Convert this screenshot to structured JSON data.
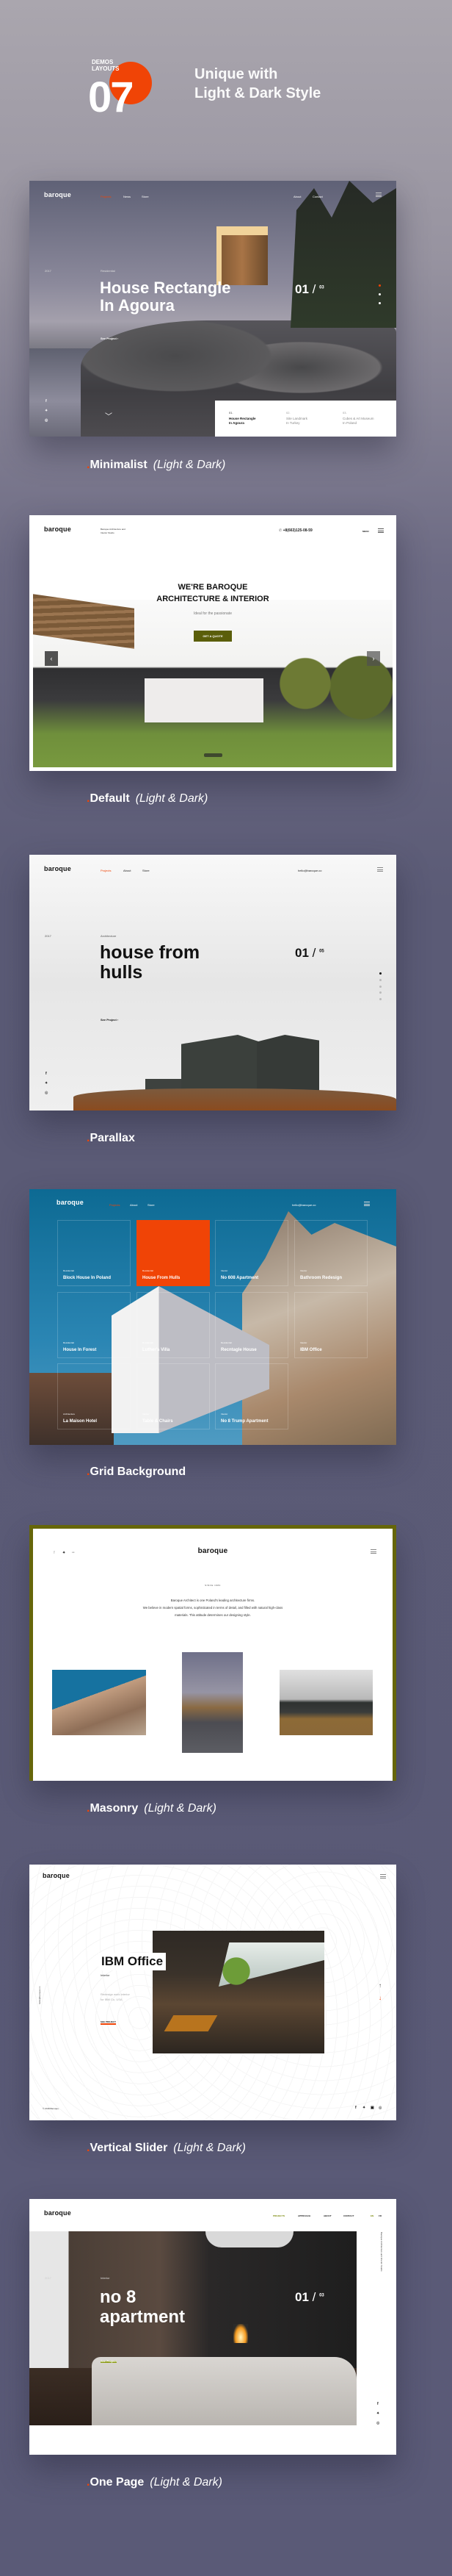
{
  "header": {
    "demos_label_line1": "DEMOS",
    "demos_label_line2": "LAYOUTS",
    "count": "07",
    "headline_line1": "Unique with",
    "headline_line2": "Light & Dark Style",
    "accent": "#f04406"
  },
  "demos": [
    {
      "label": "Minimalist",
      "note": "(Light & Dark)"
    },
    {
      "label": "Default",
      "note": "(Light & Dark)"
    },
    {
      "label": "Parallax",
      "note": ""
    },
    {
      "label": "Grid Background",
      "note": ""
    },
    {
      "label": "Masonry",
      "note": "(Light & Dark)"
    },
    {
      "label": "Vertical Slider",
      "note": "(Light & Dark)"
    },
    {
      "label": "One Page",
      "note": "(Light & Dark)"
    }
  ],
  "minimalist": {
    "logo": "baroque",
    "nav": [
      "Projects",
      "News",
      "Store"
    ],
    "nav_right": [
      "About",
      "Contact"
    ],
    "year": "2017",
    "category": "Residential",
    "title_line1": "House Rectangle",
    "title_line2": "In Agoura",
    "counter": "01",
    "total": "03",
    "see_project": "See Project",
    "slides": [
      {
        "num": "01.",
        "line1": "House Rectangle",
        "line2": "In Agoura"
      },
      {
        "num": "02.",
        "line1": "Site Landmark",
        "line2": "In Turkey"
      },
      {
        "num": "03.",
        "line1": "Cubes & Art Museum",
        "line2": "In Poland"
      }
    ]
  },
  "default": {
    "logo": "baroque",
    "tagline_line1": "Baroque Architecture and",
    "tagline_line2": "Interior Studio",
    "phone": "+8(663)125-08-59",
    "menu": "MENU",
    "heading_line1": "WE'RE BAROQUE",
    "heading_line2": "ARCHITECTURE & INTERIOR",
    "subheading": "Ideal for the passionate",
    "cta": "GET A QUOTE",
    "cta_color": "#5a5e0a"
  },
  "parallax": {
    "logo": "baroque",
    "nav": [
      "Projects",
      "About",
      "Store"
    ],
    "email": "hello@baroque.co",
    "year": "2017",
    "category": "Architecture",
    "title_line1": "house from",
    "title_line2": "hulls",
    "counter": "01",
    "total": "05",
    "see_project": "See Project"
  },
  "grid": {
    "logo": "baroque",
    "nav": [
      "Projects",
      "About",
      "Store"
    ],
    "email": "hello@baroque.co",
    "cells": [
      {
        "cat": "Residential",
        "title": "Block House In Poland"
      },
      {
        "cat": "Residential",
        "title": "House From Hulls",
        "active": true
      },
      {
        "cat": "Interior",
        "title": "No 608 Apartment"
      },
      {
        "cat": "Interior",
        "title": "Bathroom Redesign"
      },
      {
        "cat": "Residential",
        "title": "House In Forest"
      },
      {
        "cat": "Residential",
        "title": "Luther's Villa"
      },
      {
        "cat": "Residential",
        "title": "Recntagle House"
      },
      {
        "cat": "Interior",
        "title": "IBM Office"
      },
      {
        "cat": "Architecture",
        "title": "La Maison Hotel"
      },
      {
        "cat": "Interior",
        "title": "Table & Chairs"
      },
      {
        "cat": "Interior",
        "title": "No 8 Trump Apartment"
      }
    ]
  },
  "masonry": {
    "logo": "baroque",
    "since": "SINCE 1984",
    "para_line1": "Baroque Architect is one Poland's leading architecture firms.",
    "para_line2": "We believe in modern spatial forms, sophisticated in terms of detail, and filled with natural high-class",
    "para_line3": "materials. This attitude determines our designing style."
  },
  "vertical": {
    "logo": "baroque",
    "title": "IBM Office",
    "category": "Interior",
    "desc_line1": "Redesign work interior",
    "desc_line2": "for IBM Co, USA",
    "see_project": "SEE PROJECT",
    "email": "hello@baroque.co",
    "copyright": "© 2018 Baroque."
  },
  "onepage": {
    "logo": "baroque",
    "nav": [
      "PROJECTS",
      "APPROACH",
      "ABOUT",
      "CONTACT"
    ],
    "lang": [
      "EN",
      "FR"
    ],
    "side_text": "Baroque Architecture and Interior Studio",
    "year": "2017",
    "category": "Interior",
    "title_line1": "no 8",
    "title_line2": "apartment",
    "counter": "01",
    "total": "03",
    "see_project": "See Project"
  }
}
